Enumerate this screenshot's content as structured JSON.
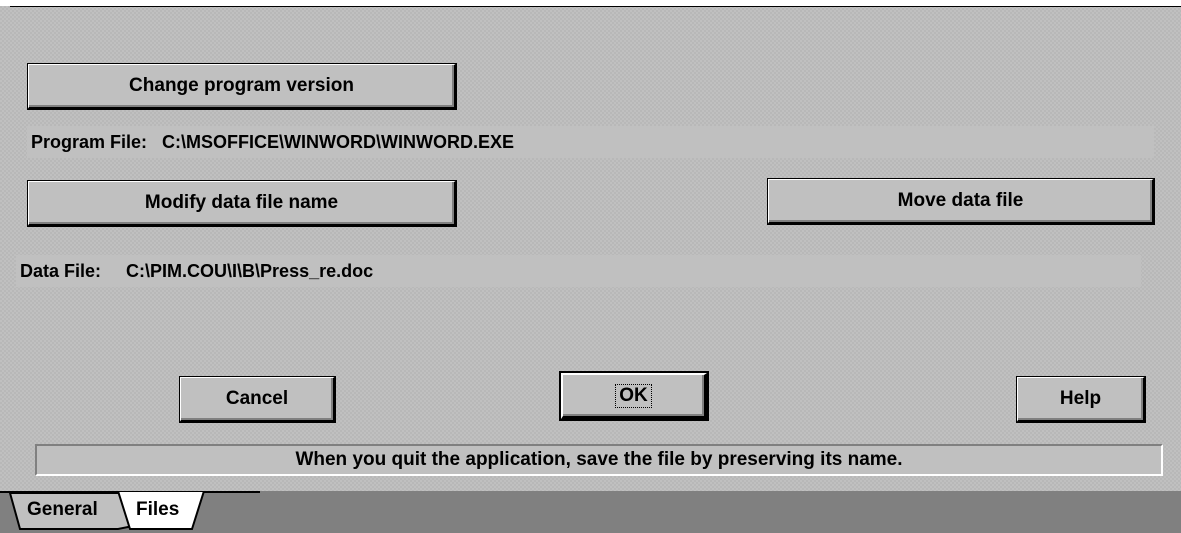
{
  "buttons": {
    "change_program_version": "Change program version",
    "modify_data_file_name": "Modify data file name",
    "move_data_file": "Move data file",
    "cancel": "Cancel",
    "ok": "OK",
    "help": "Help"
  },
  "program_file": {
    "label": "Program File:",
    "value": "C:\\MSOFFICE\\WINWORD\\WINWORD.EXE"
  },
  "data_file": {
    "label": "Data File:",
    "value": "C:\\PIM.COU\\I\\B\\Press_re.doc"
  },
  "status_message": "When you quit the application, save the file by preserving its name.",
  "tabs": [
    {
      "label": "General",
      "active": false
    },
    {
      "label": "Files",
      "active": true
    }
  ],
  "colors": {
    "face": "#c0c0c0",
    "shadow": "#808080",
    "highlight": "#ffffff",
    "dark": "#000000"
  }
}
